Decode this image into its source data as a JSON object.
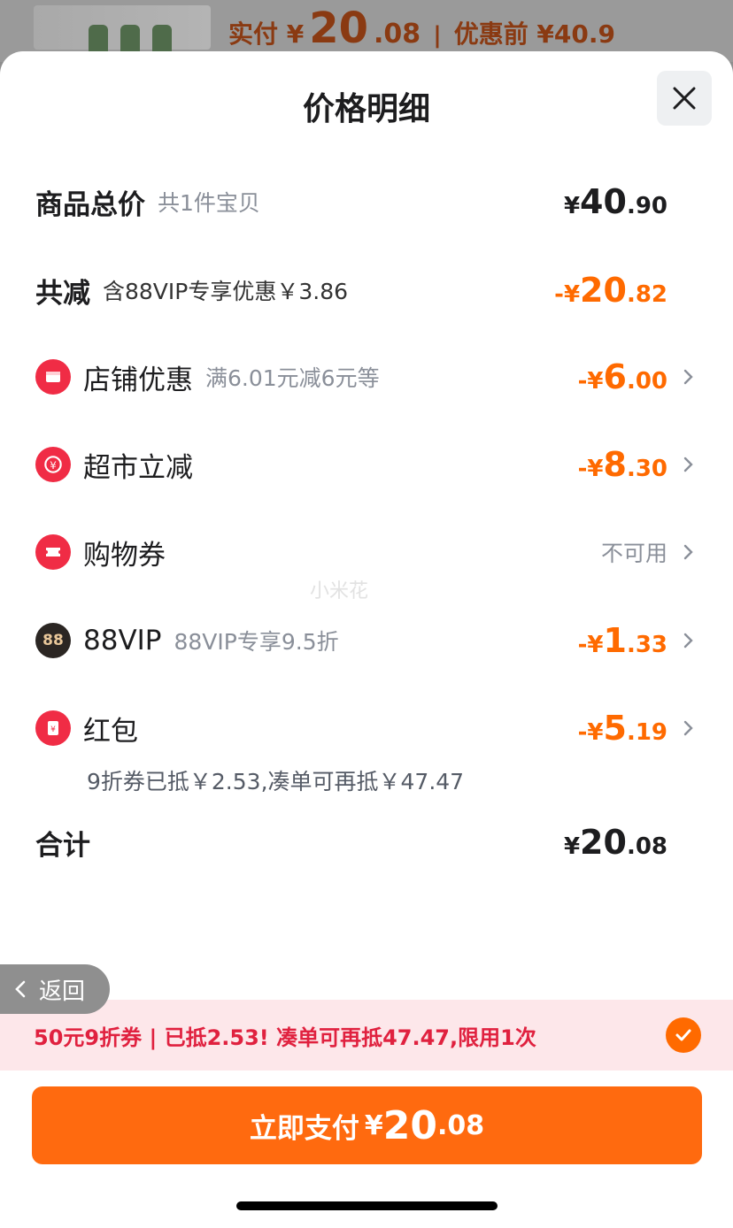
{
  "backdrop": {
    "paid_label": "实付 ¥",
    "paid_int": "20",
    "paid_dec": ".08",
    "separator": "|",
    "before_label": "优惠前 ¥40.9"
  },
  "sheet": {
    "title": "价格明细"
  },
  "rows": {
    "total": {
      "label": "商品总价",
      "sub": "共1件宝贝",
      "cur": "¥",
      "int": "40",
      "dec": ".90"
    },
    "discount": {
      "label": "共减",
      "sub": "含88VIP专享优惠￥3.86",
      "cur": "-¥",
      "int": "20",
      "dec": ".82"
    },
    "shop": {
      "label": "店铺优惠",
      "sub": "满6.01元减6元等",
      "cur": "-¥",
      "int": "6",
      "dec": ".00"
    },
    "supermarket": {
      "label": "超市立减",
      "sub": "",
      "cur": "-¥",
      "int": "8",
      "dec": ".30"
    },
    "voucher": {
      "label": "购物券",
      "status": "不可用"
    },
    "vip": {
      "label": "88VIP",
      "sub": "88VIP专享9.5折",
      "cur": "-¥",
      "int": "1",
      "dec": ".33",
      "icon_text": "88"
    },
    "redpack": {
      "label": "红包",
      "cur": "-¥",
      "int": "5",
      "dec": ".19",
      "note": "9折券已抵￥2.53,凑单可再抵￥47.47"
    },
    "sum": {
      "label": "合计",
      "cur": "¥",
      "int": "20",
      "dec": ".08"
    }
  },
  "watermark": "小米花",
  "back_button": {
    "label": "返回"
  },
  "coupon_bar": {
    "text": "50元9折券 | 已抵2.53! 凑单可再抵47.47,限用1次"
  },
  "pay_button": {
    "label": "立即支付",
    "cur": "¥",
    "int": "20",
    "dec": ".08"
  },
  "colors": {
    "accent": "#ff6a00",
    "coupon_text": "#e0213f",
    "coupon_bg": "#fde7ea",
    "icon_red": "#f02c45"
  }
}
